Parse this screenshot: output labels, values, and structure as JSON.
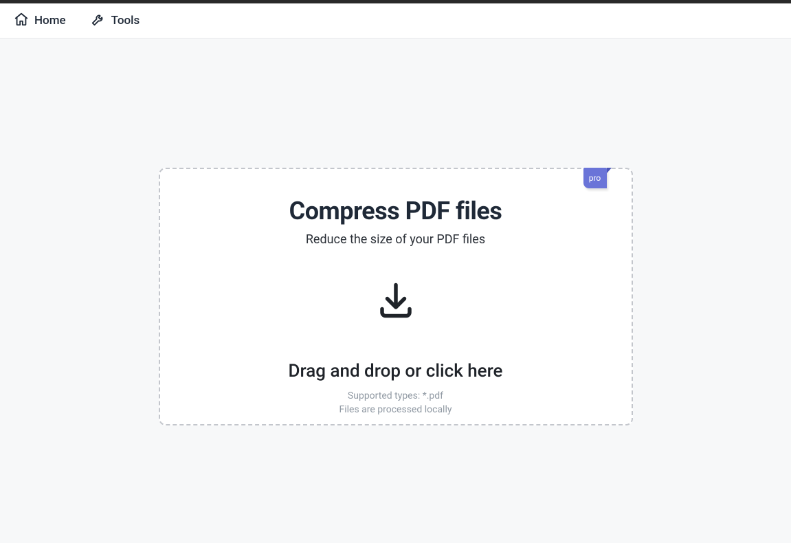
{
  "nav": {
    "home": "Home",
    "tools": "Tools"
  },
  "badge": {
    "label": "pro"
  },
  "card": {
    "title": "Compress PDF files",
    "subtitle": "Reduce the size of your PDF files",
    "drop_text": "Drag and drop or click here",
    "supported": "Supported types: *.pdf",
    "local": "Files are processed locally"
  }
}
